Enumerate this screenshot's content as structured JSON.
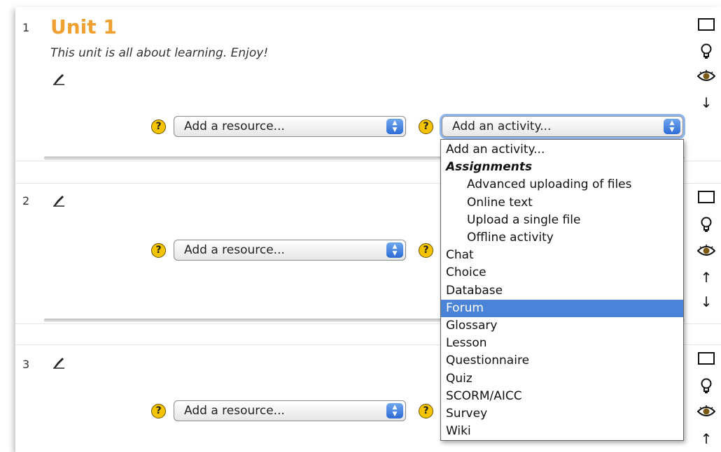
{
  "sections": [
    {
      "number": "1",
      "title": "Unit 1",
      "summary": "This unit is all about learning. Enjoy!"
    },
    {
      "number": "2"
    },
    {
      "number": "3"
    }
  ],
  "resource_select": {
    "selected": "Add a resource..."
  },
  "activity_select": {
    "selected": "Add an activity...",
    "options": [
      {
        "label": "Add an activity...",
        "kind": "option"
      },
      {
        "label": "Assignments",
        "kind": "group"
      },
      {
        "label": "Advanced uploading of files",
        "kind": "sub"
      },
      {
        "label": "Online text",
        "kind": "sub"
      },
      {
        "label": "Upload a single file",
        "kind": "sub"
      },
      {
        "label": "Offline activity",
        "kind": "sub"
      },
      {
        "label": "Chat",
        "kind": "option"
      },
      {
        "label": "Choice",
        "kind": "option"
      },
      {
        "label": "Database",
        "kind": "option"
      },
      {
        "label": "Forum",
        "kind": "option",
        "highlighted": true
      },
      {
        "label": "Glossary",
        "kind": "option"
      },
      {
        "label": "Lesson",
        "kind": "option"
      },
      {
        "label": "Questionnaire",
        "kind": "option"
      },
      {
        "label": "Quiz",
        "kind": "option"
      },
      {
        "label": "SCORM/AICC",
        "kind": "option"
      },
      {
        "label": "Survey",
        "kind": "option"
      },
      {
        "label": "Wiki",
        "kind": "option"
      }
    ]
  },
  "help_glyph": "?",
  "colors": {
    "title": "#f0a030",
    "highlight": "#4a83d8",
    "help": "#f5c400"
  },
  "icons": [
    "edit-icon",
    "help-icon",
    "highlight-section-icon",
    "lightbulb-icon",
    "eye-icon",
    "move-up-icon",
    "move-down-icon"
  ]
}
